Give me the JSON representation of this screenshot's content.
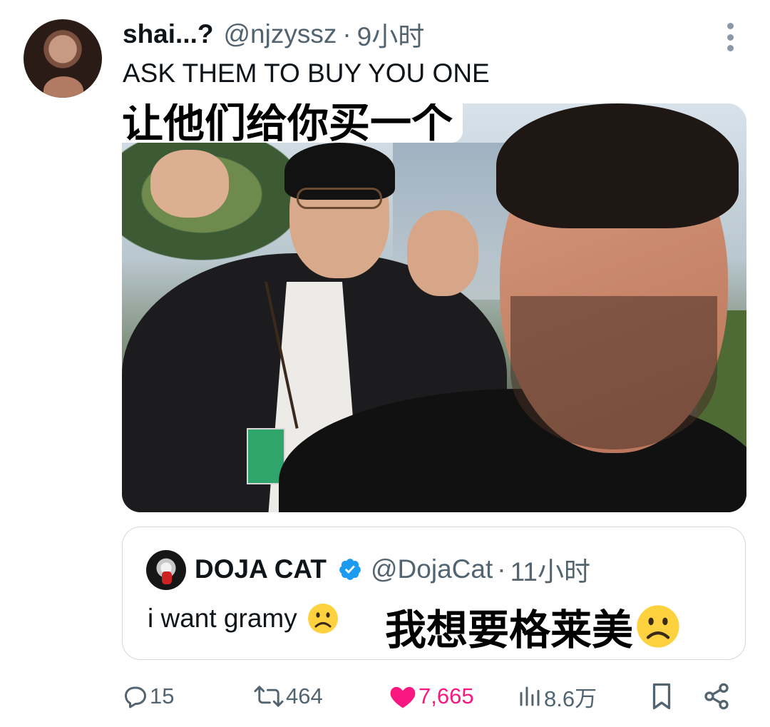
{
  "tweet": {
    "display_name": "shai...?",
    "handle": "@njzyssz",
    "separator": "·",
    "time": "9小时",
    "text": "ASK THEM TO BUY YOU ONE",
    "image_caption": "让他们给你买一个",
    "more_icon": "more-vertical-icon"
  },
  "quote": {
    "name": "DOJA CAT",
    "handle": "@DojaCat",
    "separator": "·",
    "time": "11小时",
    "text": "i want gramy",
    "translation": "我想要格莱美",
    "verified_color": "#1d9bf0",
    "emoji": "frowning-face"
  },
  "actions": {
    "replies": "15",
    "reposts": "464",
    "likes": "7,665",
    "views": "8.6万",
    "like_color": "#f91880",
    "icons": [
      "reply-icon",
      "repost-icon",
      "heart-icon",
      "views-icon",
      "bookmark-icon",
      "share-icon"
    ]
  }
}
